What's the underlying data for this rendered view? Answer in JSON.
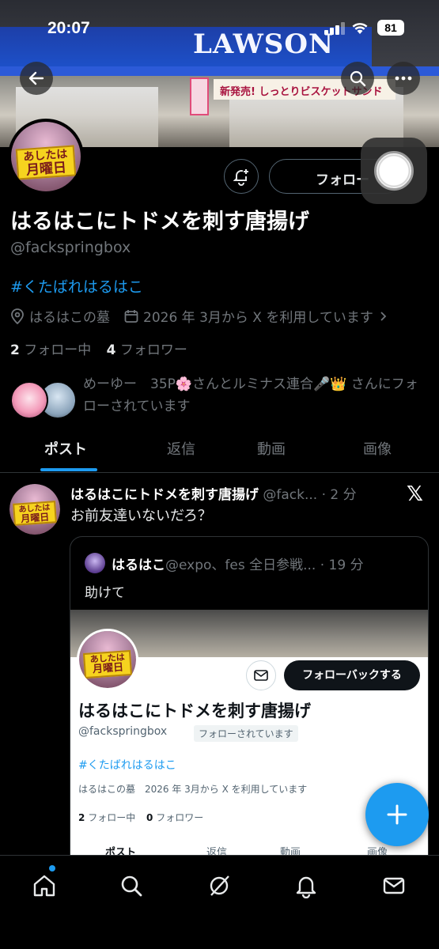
{
  "status_bar": {
    "time": "20:07",
    "battery": "81"
  },
  "banner": {
    "store_sign": "LAWSON",
    "poster_text": "新発売! しっとりビスケットサンド"
  },
  "profile": {
    "avatar_text": [
      "あしたは",
      "月曜日"
    ],
    "follow_label": "フォロー",
    "display_name": "はるはこにトドメを刺す唐揚げ",
    "handle": "@fackspringbox",
    "bio_hashtag": "#くたばれはるはこ",
    "location": "はるはこの墓",
    "joined": "2026 年 3月から X を利用しています",
    "following_count": "2",
    "following_label": "フォロー中",
    "followers_count": "4",
    "followers_label": "フォロワー",
    "followed_by_text": "めーゆー　35P🌸さんとルミナス連合🎤👑 さんにフォローされています"
  },
  "tabs": [
    {
      "label": "ポスト",
      "active": true
    },
    {
      "label": "返信",
      "active": false
    },
    {
      "label": "動画",
      "active": false
    },
    {
      "label": "画像",
      "active": false
    }
  ],
  "post": {
    "author": "はるはこにトドメを刺す唐揚げ",
    "handle_time": " @fack... · 2 分",
    "text": "お前友達いないだろ？",
    "quote": {
      "author": "はるはこ",
      "handle_time": " @expo、fes 全日参戦... · 19 分",
      "text": "助けて",
      "screenshot": {
        "followback_label": "フォローバックする",
        "name": "はるはこにトドメを刺す唐揚げ",
        "handle": "@fackspringbox",
        "followed_badge": "フォローされています",
        "hashtag": "#くたばれはるはこ",
        "meta": "はるはこの墓　2026 年 3月から X を利用しています",
        "following_count": "2",
        "following_label": "フォロー中",
        "followers_count": "0",
        "followers_label": "フォロワー",
        "tabs": [
          "ポスト",
          "返信",
          "動画",
          "画像"
        ]
      }
    }
  },
  "colors": {
    "accent": "#1d9bf0",
    "muted": "#71767b",
    "border": "#2f3336"
  }
}
